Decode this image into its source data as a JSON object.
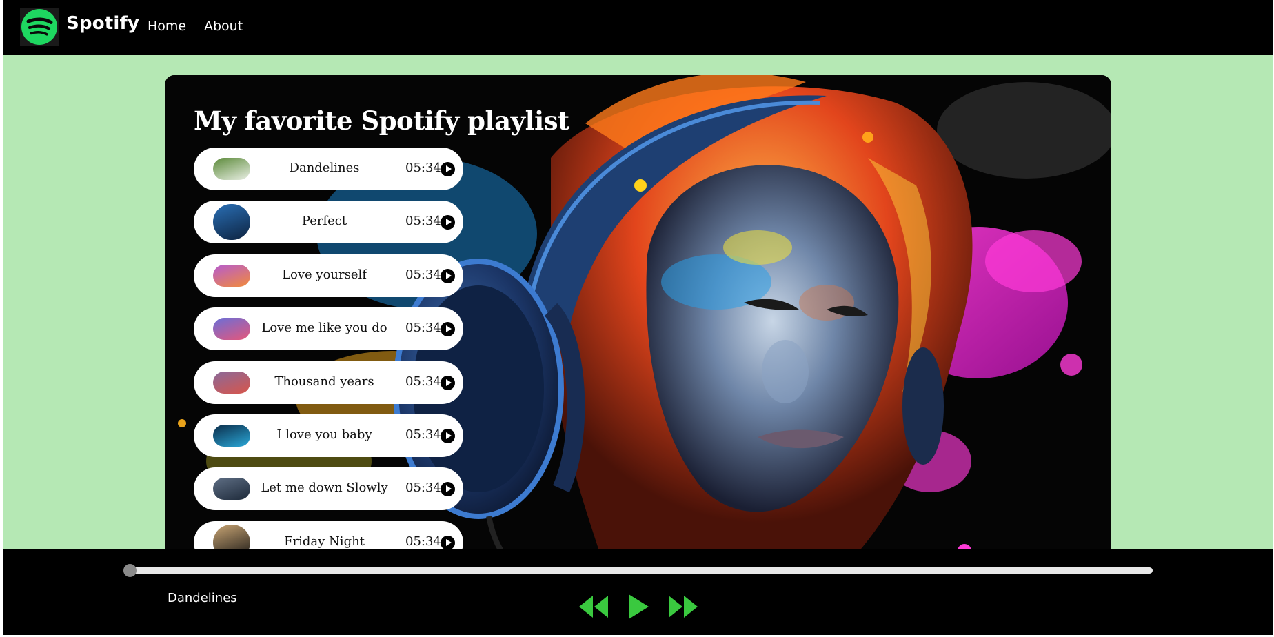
{
  "nav": {
    "brand": "Spotify",
    "links": [
      {
        "label": "Home"
      },
      {
        "label": "About"
      }
    ]
  },
  "main": {
    "title": "My favorite Spotify playlist",
    "songs": [
      {
        "name": "Dandelines",
        "duration": "05:34",
        "thumb_colors": [
          "#5c8a3a",
          "#e9efe4"
        ]
      },
      {
        "name": "Perfect",
        "duration": "05:34",
        "thumb_colors": [
          "#2a6fb5",
          "#0d2340"
        ]
      },
      {
        "name": "Love yourself",
        "duration": "05:34",
        "thumb_colors": [
          "#b55bd0",
          "#f28a3a"
        ]
      },
      {
        "name": "Love me like you do",
        "duration": "05:34",
        "thumb_colors": [
          "#6a6fd8",
          "#e6567a"
        ]
      },
      {
        "name": "Thousand years",
        "duration": "05:34",
        "thumb_colors": [
          "#8a6a9a",
          "#d8554a"
        ]
      },
      {
        "name": "I love you baby",
        "duration": "05:34",
        "thumb_colors": [
          "#0b2d4a",
          "#2aa8d8"
        ]
      },
      {
        "name": "Let me down Slowly",
        "duration": "05:34",
        "thumb_colors": [
          "#5e6e84",
          "#1e2a3a"
        ]
      },
      {
        "name": "Friday Night",
        "duration": "05:34",
        "thumb_colors": [
          "#c9a574",
          "#111111"
        ]
      }
    ]
  },
  "player": {
    "now_playing": "Dandelines",
    "progress": 0,
    "accent_color": "#3ac93f",
    "controls": [
      "rewind-icon",
      "play-icon",
      "fast-forward-icon"
    ]
  },
  "colors": {
    "page_background": "#b5e8b4",
    "bars": "#000000",
    "spotify_green": "#1ed760"
  }
}
